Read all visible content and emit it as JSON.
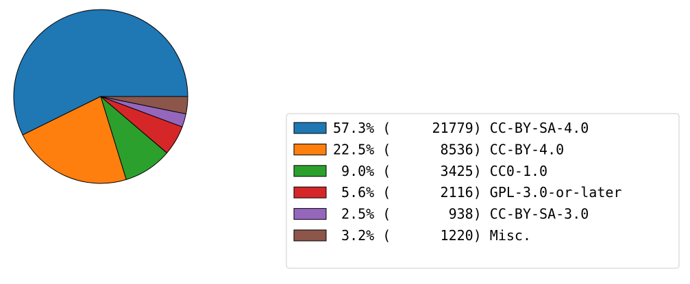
{
  "chart_data": {
    "type": "pie",
    "start_angle_deg": 0,
    "direction": "counterclockwise",
    "slices": [
      {
        "pct": "57.3%",
        "count": "21779",
        "label": "CC-BY-SA-4.0",
        "value": 21779,
        "color": "#1f77b4"
      },
      {
        "pct": "22.5%",
        "count": "8536",
        "label": "CC-BY-4.0",
        "value": 8536,
        "color": "#ff7f0e"
      },
      {
        "pct": "9.0%",
        "count": "3425",
        "label": "CC0-1.0",
        "value": 3425,
        "color": "#2ca02c"
      },
      {
        "pct": "5.6%",
        "count": "2116",
        "label": "GPL-3.0-or-later",
        "value": 2116,
        "color": "#d62728"
      },
      {
        "pct": "2.5%",
        "count": "938",
        "label": "CC-BY-SA-3.0",
        "value": 938,
        "color": "#9467bd"
      },
      {
        "pct": "3.2%",
        "count": "1220",
        "label": "Misc.",
        "value": 1220,
        "color": "#8c564b"
      }
    ],
    "legend_placement": "bottom-right",
    "edge_color": "#000000"
  }
}
